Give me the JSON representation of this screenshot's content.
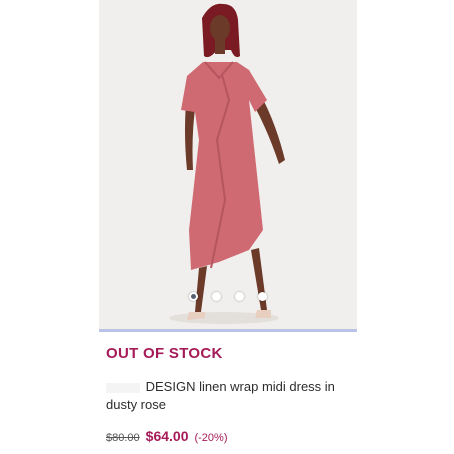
{
  "product": {
    "stock_status": "OUT OF STOCK",
    "title": "DESIGN linen wrap midi dress in dusty rose",
    "price_original": "$80.00",
    "price_current": "$64.00",
    "discount": "(-20%)"
  },
  "gallery": {
    "image_count": 4,
    "active_index": 0
  },
  "colors": {
    "accent": "#a51b58",
    "dress": "#cf6a72",
    "background": "#f1efed"
  }
}
